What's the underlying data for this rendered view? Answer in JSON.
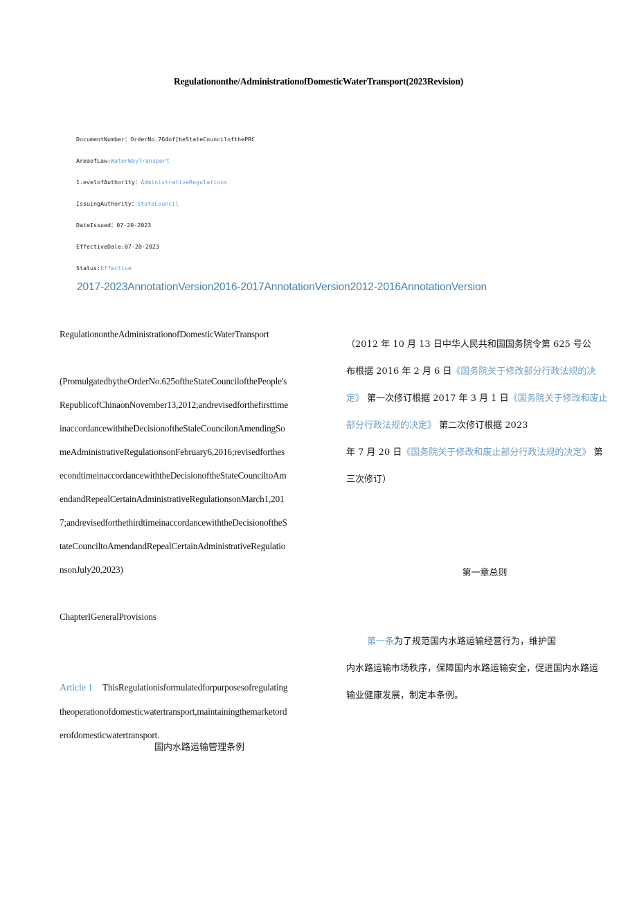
{
  "document": {
    "title": "Regulationonthe/AdministrationofDomesticWaterTransport(2023Revision)",
    "colors": {
      "link": "#5b9bd5",
      "annotation_link": "#4a7fa8",
      "article_label": "#5b8fb9",
      "zh_accent": "#6f9dc4",
      "body_text": "#131313",
      "background": "#ffffff"
    }
  },
  "metadata": [
    {
      "label": "DocumentNumber：",
      "value": "OrderNo.764of[heStateCouncilofthePRC",
      "is_link": false
    },
    {
      "label": "AreaofLaw:",
      "value": "WaterWayTransport",
      "is_link": true
    },
    {
      "label": "1.evelofAuthority：",
      "value": "AdministrativeRegulations",
      "is_link": true
    },
    {
      "label": "IssuingAuthority：",
      "value": "StateCouncil",
      "is_link": true
    },
    {
      "label": "DateIssued：",
      "value": "07-20-2023",
      "is_link": false
    },
    {
      "label": "EffectiveDale:",
      "value": "07-20-2023",
      "is_link": false
    },
    {
      "label": "Status:",
      "value": "Effective",
      "is_link": true
    }
  ],
  "annotation_versions": [
    "2017-2023AnnotationVersion",
    "2016-2017AnnotationVersion",
    "2012-2016AnnotationVersion"
  ],
  "english_column": {
    "heading": "RegulationontheAdministrationofDomesticWaterTransport",
    "promulgation_lines": [
      "(PromulgatedbytheOrderNo.625oftheStateCouncilofthePeople's",
      "RepublicofChinaonNovember13,2012;andrevisedforthefirsttime",
      "inaccordancewiththeDecisionoftheStaleCouncilonAmendingSo",
      "meAdministrativeRegulationsonFebruary6,2016;revisedforthes",
      "econdtimeinaccordancewiththeDecisionoftheStateCounciltoAm",
      "endandRepealCertainAdministrativeRegulationsonMarch1,201",
      "7;andrevisedforthethirdtimeinaccordancewiththeDecisionoftheS",
      "tateCounciltoAmendandRepealCertainAdministrativeRegulatio",
      "nsonJuly20,2023)"
    ],
    "chapter_heading": "ChapterIGeneralProvisions",
    "article": {
      "label": "Article 1",
      "lines": [
        "ThisRegulationisformulatedforpurposesofregulating",
        "theoperationofdomesticwatertransport,maintainingthemarketord",
        "erofdomesticwatertransport."
      ]
    },
    "chinese_title_footer": "国内水路运输管理条例"
  },
  "chinese_column": {
    "promulgation": {
      "line1_plain": "（2012 年 10 月 13 日中华人民共和国国务院令第 625 号公",
      "line2_plain": "布根据 2016 年 2 月 6 日",
      "line2_accent": "《国务院关于修改部分行政法规的决",
      "line3_accent": "定》",
      "line3_plain": " 第一次修订根据 2017 年 3 月 1 日",
      "line3_accent2": "《国务院关于修改和废止",
      "line4_accent": "部分行政法规的决定》",
      "line4_plain": " 第二次修订根据 2023",
      "line5_plain": "年 7 月 20 日",
      "line5_accent": "《国务院关于修改和废止部分行政法规的决定》",
      "line5_plain2": " 第",
      "line6_plain": "三次修订）"
    },
    "chapter_heading": "第一章总则",
    "article": {
      "label": "第一条",
      "line1": "为了规范国内水路运输经营行为，维护国",
      "line2": "内水路运输市场秩序，保障国内水路运输安全，促进国内水路运",
      "line3": "输业健康发展，制定本条例。"
    }
  }
}
